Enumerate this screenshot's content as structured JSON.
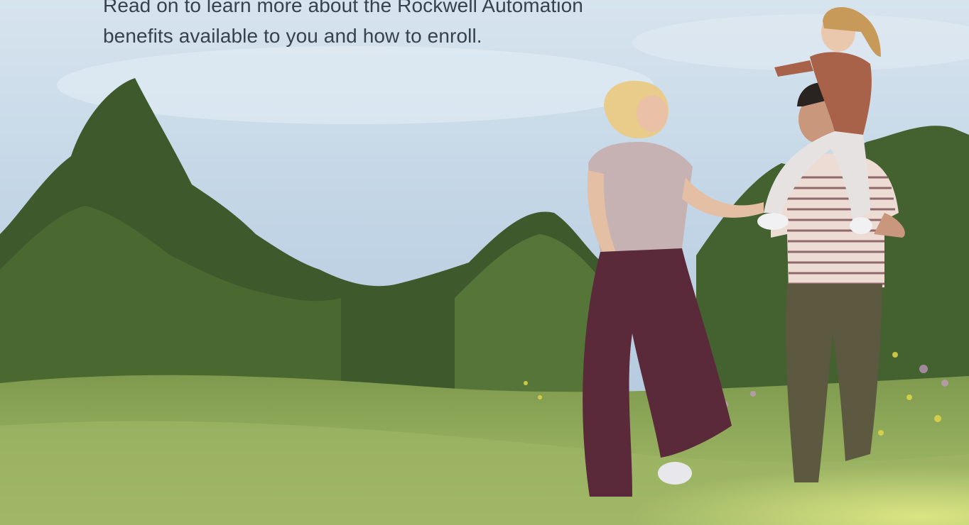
{
  "intro": {
    "line1": "Read on to learn more about the Rockwell Automation",
    "line2": "benefits available to you and how to enroll."
  },
  "hero": {
    "image": "photo-family-walking-in-meadow"
  },
  "colors": {
    "text": "#36434f",
    "sky": "#c7d9e9",
    "grass": "#8ea95b"
  }
}
